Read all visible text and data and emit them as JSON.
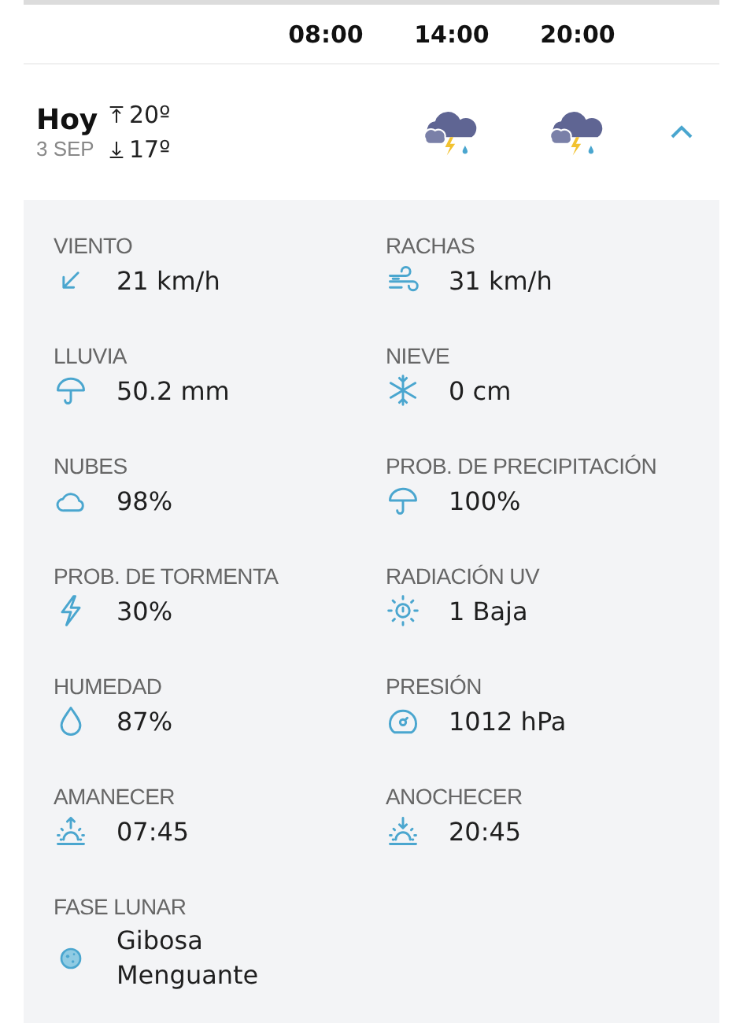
{
  "hours": [
    {
      "time": "08:00"
    },
    {
      "time": "14:00",
      "kind": "storm"
    },
    {
      "time": "20:00",
      "kind": "storm"
    }
  ],
  "day": {
    "name": "Hoy",
    "date": "3 SEP",
    "max": "20º",
    "min": "17º",
    "expanded": true
  },
  "details": [
    {
      "label": "VIENTO",
      "value": "21 km/h",
      "kind": "wind_direction"
    },
    {
      "label": "RACHAS",
      "value": "31 km/h",
      "kind": "gusts"
    },
    {
      "label": "LLUVIA",
      "value": "50.2 mm",
      "kind": "rain"
    },
    {
      "label": "NIEVE",
      "value": "0 cm",
      "kind": "snow"
    },
    {
      "label": "NUBES",
      "value": "98%",
      "kind": "clouds"
    },
    {
      "label": "PROB. DE PRECIPITACIÓN",
      "value": "100%",
      "kind": "rain"
    },
    {
      "label": "PROB. DE TORMENTA",
      "value": "30%",
      "kind": "storm"
    },
    {
      "label": "RADIACIÓN UV",
      "value": "1 Baja",
      "kind": "uv"
    },
    {
      "label": "HUMEDAD",
      "value": "87%",
      "kind": "humidity"
    },
    {
      "label": "PRESIÓN",
      "value": "1012 hPa",
      "kind": "pressure"
    },
    {
      "label": "AMANECER",
      "value": "07:45",
      "kind": "sunrise"
    },
    {
      "label": "ANOCHECER",
      "value": "20:45",
      "kind": "sunset"
    },
    {
      "label": "FASE LUNAR",
      "value": "Gibosa Menguante",
      "kind": "moon"
    }
  ]
}
